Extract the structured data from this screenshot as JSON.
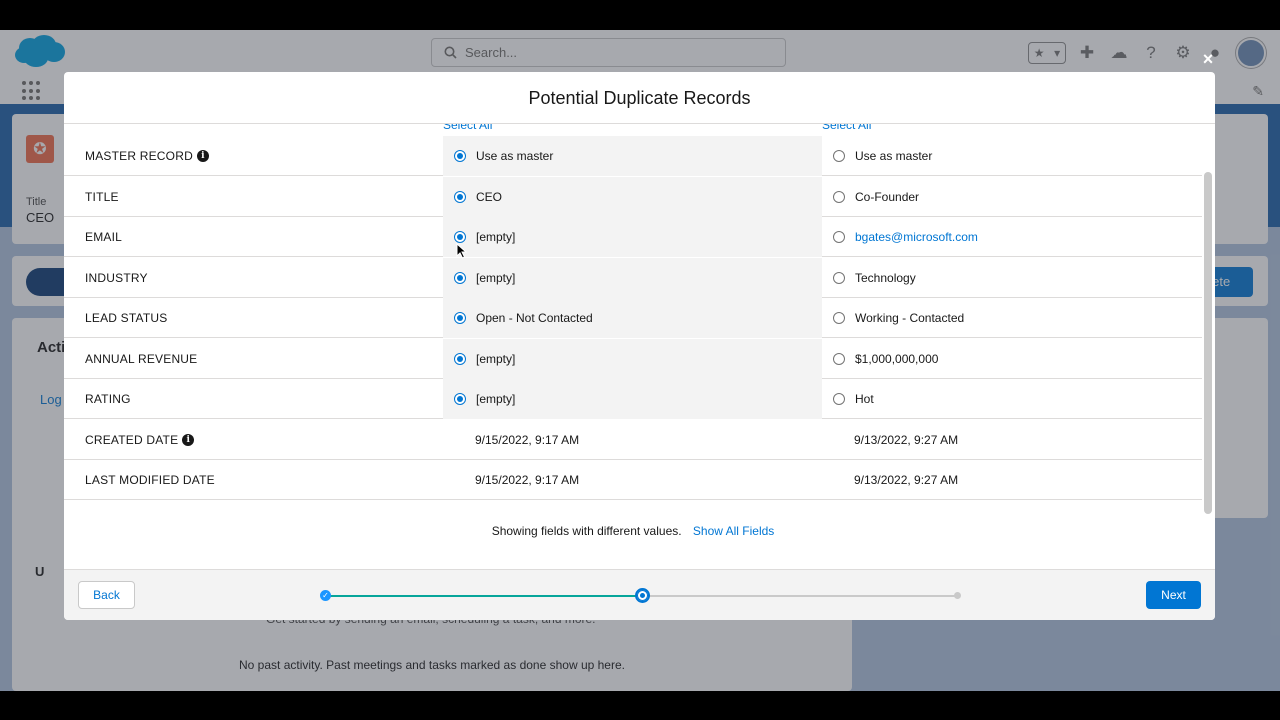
{
  "app": {
    "search_placeholder": "Search...",
    "record_title_label": "Title",
    "record_title_value": "CEO",
    "bg_button_fragment": "plete",
    "activity_tab_fragment": "Acti",
    "log_fragment": "Log",
    "upcoming_fragment": "U",
    "get_started_text": "Get started by sending an email, scheduling a task, and more.",
    "no_past_text": "No past activity. Past meetings and tasks marked as done show up here."
  },
  "modal": {
    "title": "Potential Duplicate Records",
    "close_label": "×",
    "select_all_label": "Select All",
    "rows": [
      {
        "label": "MASTER RECORD",
        "info": true,
        "master": "Use as master",
        "other": "Use as master",
        "selectable": true
      },
      {
        "label": "TITLE",
        "info": false,
        "master": "CEO",
        "other": "Co-Founder",
        "selectable": true
      },
      {
        "label": "EMAIL",
        "info": false,
        "master": "[empty]",
        "other": "bgates@microsoft.com",
        "selectable": true,
        "other_is_link": true
      },
      {
        "label": "INDUSTRY",
        "info": false,
        "master": "[empty]",
        "other": "Technology",
        "selectable": true
      },
      {
        "label": "LEAD STATUS",
        "info": false,
        "master": "Open - Not Contacted",
        "other": "Working - Contacted",
        "selectable": true
      },
      {
        "label": "ANNUAL REVENUE",
        "info": false,
        "master": "[empty]",
        "other": "$1,000,000,000",
        "selectable": true
      },
      {
        "label": "RATING",
        "info": false,
        "master": "[empty]",
        "other": "Hot",
        "selectable": true
      },
      {
        "label": "CREATED DATE",
        "info": true,
        "master": "9/15/2022, 9:17 AM",
        "other": "9/13/2022, 9:27 AM",
        "selectable": false
      },
      {
        "label": "LAST MODIFIED DATE",
        "info": false,
        "master": "9/15/2022, 9:17 AM",
        "other": "9/13/2022, 9:27 AM",
        "selectable": false
      }
    ],
    "note_text": "Showing fields with different values.",
    "show_all_label": "Show All Fields",
    "back_label": "Back",
    "next_label": "Next",
    "progress": {
      "current_step": 2,
      "total_steps": 3
    }
  },
  "colors": {
    "brand": "#0176d3",
    "progress_done": "#06a59a",
    "header_blue": "#1b5fa8"
  }
}
